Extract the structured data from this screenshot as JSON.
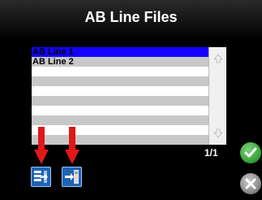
{
  "header": {
    "title": "AB Line Files"
  },
  "list": {
    "items": [
      {
        "label": "AB Line 1"
      },
      {
        "label": "AB Line 2"
      },
      {
        "label": ""
      },
      {
        "label": ""
      },
      {
        "label": ""
      },
      {
        "label": ""
      },
      {
        "label": ""
      },
      {
        "label": ""
      },
      {
        "label": ""
      },
      {
        "label": ""
      }
    ],
    "selected_index": 0
  },
  "pagination": {
    "indicator": "1/1"
  },
  "toolbar": {
    "icons": [
      "import-list-icon",
      "export-file-icon"
    ]
  },
  "actions": {
    "confirm_icon": "checkmark-icon",
    "cancel_icon": "x-icon"
  },
  "colors": {
    "selection": "#1500ff",
    "accent_blue": "#1f63b6",
    "confirm_green": "#3aa83a",
    "cancel_gray": "#8c8c8c",
    "annotation_red": "#e01818"
  }
}
